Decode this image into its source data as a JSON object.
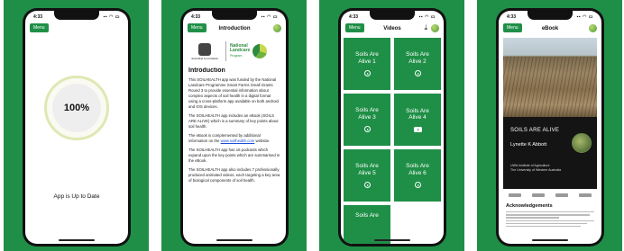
{
  "colors": {
    "brand_green": "#1f8f47",
    "link_blue": "#1a4fd6"
  },
  "screens": {
    "update": {
      "status_time": "4:33",
      "menu_label": "Menu",
      "progress_text": "100%",
      "progress_value": 1.0,
      "message": "App is Up to Date"
    },
    "intro": {
      "status_time": "4:33",
      "menu_label": "Menu",
      "title": "Introduction",
      "gov_logo_text": "Australian Government",
      "landcare_line1": "National",
      "landcare_line2": "Landcare",
      "landcare_line3": "Program",
      "heading": "Introduction",
      "p1": "This SOILHEALTH app was funded by the National Landcare Programme Smart Farms Small Grants Round 3 to provide essential information about complex aspects of soil health in a digital format using a cross-platform app available on both android and IOS devices.",
      "p2": "The SOILHEALTH app includes an eBook (SOILS ARE ALIVE) which is a summary of key points about soil health.",
      "p3_before": "The eBook is complemented by additional information on the ",
      "p3_link": "www.soilhealth.com",
      "p3_after": " website.",
      "p4": "The SOILHEALTH app has 16 podcasts which expand upon the key points which are summarised in the eBook.",
      "p5": "The SOILHEALTH app also includes 7 professionally produced animated videos, each targeting a key area of biological components of soil health."
    },
    "videos": {
      "status_time": "4:33",
      "menu_label": "Menu",
      "title": "Videos",
      "cards": [
        {
          "label": "Soils Are Alive 1",
          "icon": "play-circle-icon"
        },
        {
          "label": "Soils Are Alive 2",
          "icon": "play-circle-icon"
        },
        {
          "label": "Soils Are Alive 3",
          "icon": "play-circle-icon"
        },
        {
          "label": "Soils Are Alive 4",
          "icon": "youtube-icon"
        },
        {
          "label": "Soils Are Alive 5",
          "icon": "play-circle-icon"
        },
        {
          "label": "Soils Are Alive 6",
          "icon": "play-circle-icon"
        },
        {
          "label": "Soils Are",
          "icon": ""
        }
      ]
    },
    "ebook": {
      "status_time": "4:33",
      "menu_label": "Menu",
      "title": "eBook",
      "cover_title": "SOILS ARE ALIVE",
      "cover_author": "Lynette K Abbott",
      "cover_inst1": "UWA Institute of Agriculture",
      "cover_inst2": "The University of Western Australia",
      "ack_heading": "Acknowledgements"
    }
  }
}
